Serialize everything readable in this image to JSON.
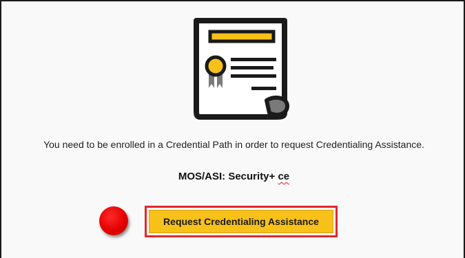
{
  "enrollment_notice": {
    "message": "You need to be enrolled in a Credential Path in order to request Credentialing Assistance.",
    "mos_label": "MOS/ASI: Security+",
    "mos_suffix": "ce"
  },
  "actions": {
    "request_label": "Request Credentialing Assistance"
  },
  "icons": {
    "certificate": "certificate-icon",
    "marker": "red-dot-marker"
  },
  "colors": {
    "accent_yellow": "#f7c11a",
    "button_outline_red": "#e3262b",
    "marker_red": "#e40000",
    "icon_dark": "#1a1a1a",
    "icon_gray": "#7a7a7a"
  }
}
